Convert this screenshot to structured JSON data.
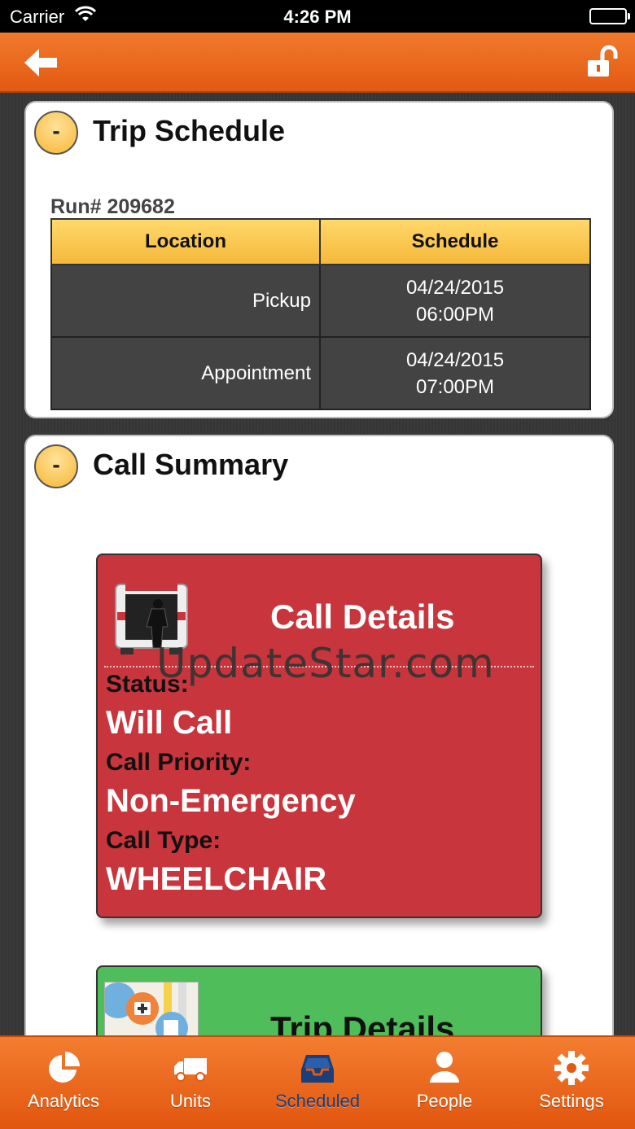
{
  "status_bar": {
    "carrier": "Carrier",
    "time": "4:26 PM"
  },
  "nav": {
    "back_icon": "back-arrow-icon",
    "lock_icon": "unlock-icon"
  },
  "trip_schedule": {
    "toggle": "-",
    "title": "Trip Schedule",
    "run_label": "Run# 209682",
    "columns": [
      "Location",
      "Schedule"
    ],
    "rows": [
      {
        "location": "Pickup",
        "date": "04/24/2015",
        "time": "06:00PM"
      },
      {
        "location": "Appointment",
        "date": "04/24/2015",
        "time": "07:00PM"
      }
    ]
  },
  "call_summary": {
    "toggle": "-",
    "title": "Call Summary",
    "call_details": {
      "title": "Call Details",
      "status_label": "Status:",
      "status_value": "Will Call",
      "priority_label": "Call Priority:",
      "priority_value": "Non-Emergency",
      "type_label": "Call Type:",
      "type_value": "WHEELCHAIR"
    },
    "trip_details": {
      "title": "Trip Details"
    }
  },
  "watermark": "UpdateStar.com",
  "tabs": [
    {
      "label": "Analytics",
      "icon": "pie-chart-icon",
      "active": false
    },
    {
      "label": "Units",
      "icon": "truck-icon",
      "active": false
    },
    {
      "label": "Scheduled",
      "icon": "inbox-icon",
      "active": true
    },
    {
      "label": "People",
      "icon": "person-icon",
      "active": false
    },
    {
      "label": "Settings",
      "icon": "gear-icon",
      "active": false
    }
  ],
  "colors": {
    "accent_orange": "#e8641b",
    "header_yellow": "#f5b93a",
    "call_card_red": "#c8353c",
    "trip_card_green": "#4fbd5a",
    "active_tab": "#1b3f7a"
  }
}
